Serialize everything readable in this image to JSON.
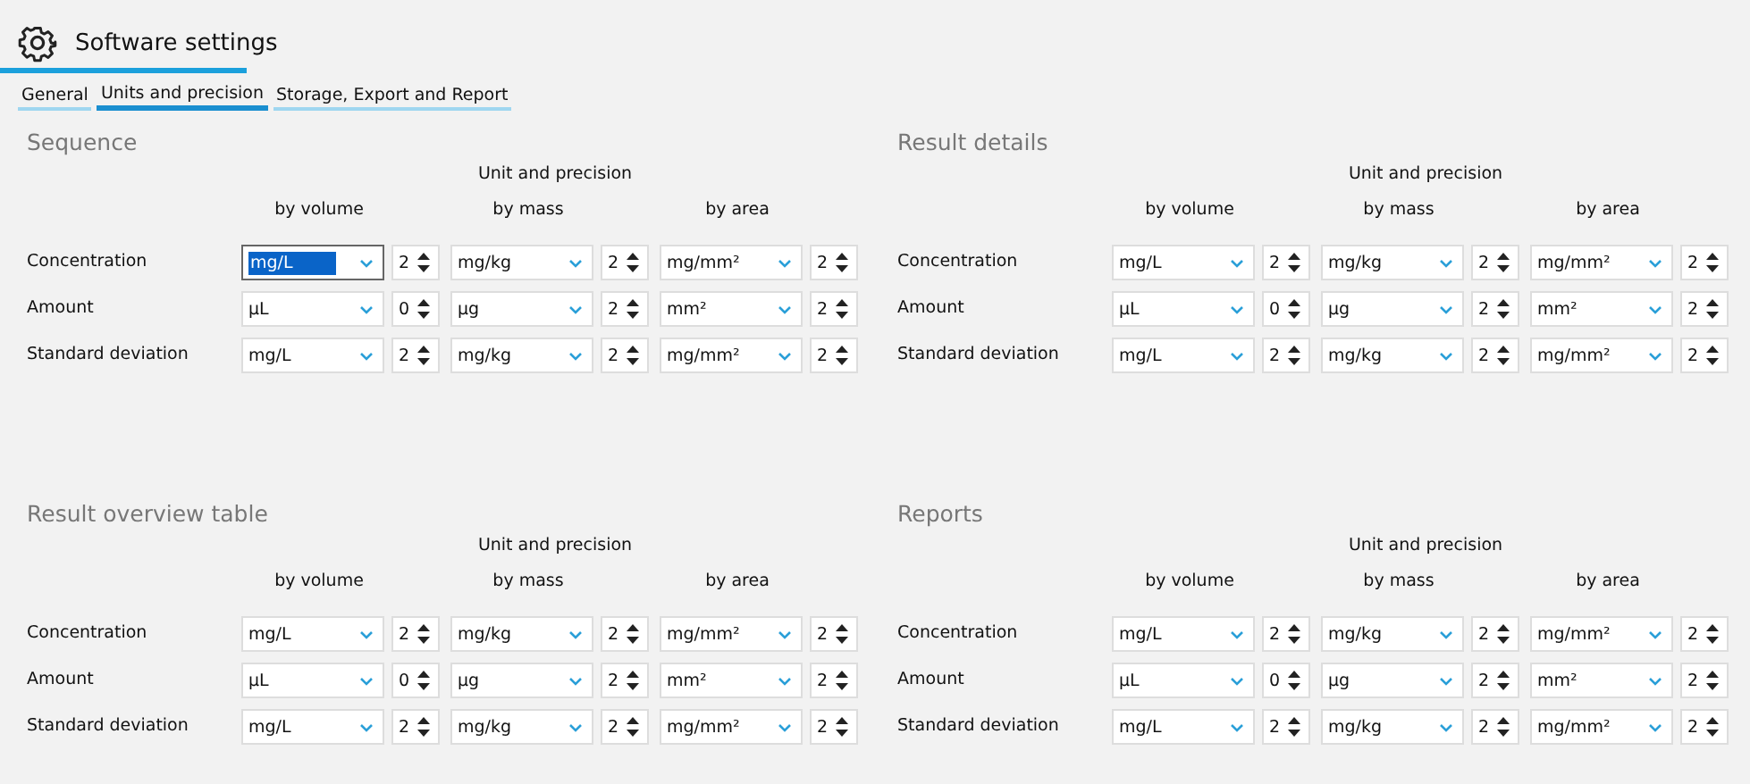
{
  "window": {
    "title": "Software settings"
  },
  "tabs": [
    {
      "label": "General",
      "selected": false
    },
    {
      "label": "Units and precision",
      "selected": true
    },
    {
      "label": "Storage, Export and Report",
      "selected": false
    }
  ],
  "sections": [
    {
      "title": "Sequence",
      "group_heading": "Unit and precision",
      "columns": [
        "by volume",
        "by mass",
        "by area"
      ],
      "rows": [
        {
          "label": "Concentration",
          "cells": [
            {
              "unit": "mg/L",
              "precision": "2",
              "focused": true
            },
            {
              "unit": "mg/kg",
              "precision": "2",
              "focused": false
            },
            {
              "unit": "mg/mm²",
              "precision": "2",
              "focused": false
            }
          ]
        },
        {
          "label": "Amount",
          "cells": [
            {
              "unit": "µL",
              "precision": "0",
              "focused": false
            },
            {
              "unit": "µg",
              "precision": "2",
              "focused": false
            },
            {
              "unit": "mm²",
              "precision": "2",
              "focused": false
            }
          ]
        },
        {
          "label": "Standard deviation",
          "cells": [
            {
              "unit": "mg/L",
              "precision": "2",
              "focused": false
            },
            {
              "unit": "mg/kg",
              "precision": "2",
              "focused": false
            },
            {
              "unit": "mg/mm²",
              "precision": "2",
              "focused": false
            }
          ]
        }
      ]
    },
    {
      "title": "Result details",
      "group_heading": "Unit and precision",
      "columns": [
        "by volume",
        "by mass",
        "by area"
      ],
      "rows": [
        {
          "label": "Concentration",
          "cells": [
            {
              "unit": "mg/L",
              "precision": "2",
              "focused": false
            },
            {
              "unit": "mg/kg",
              "precision": "2",
              "focused": false
            },
            {
              "unit": "mg/mm²",
              "precision": "2",
              "focused": false
            }
          ]
        },
        {
          "label": "Amount",
          "cells": [
            {
              "unit": "µL",
              "precision": "0",
              "focused": false
            },
            {
              "unit": "µg",
              "precision": "2",
              "focused": false
            },
            {
              "unit": "mm²",
              "precision": "2",
              "focused": false
            }
          ]
        },
        {
          "label": "Standard deviation",
          "cells": [
            {
              "unit": "mg/L",
              "precision": "2",
              "focused": false
            },
            {
              "unit": "mg/kg",
              "precision": "2",
              "focused": false
            },
            {
              "unit": "mg/mm²",
              "precision": "2",
              "focused": false
            }
          ]
        }
      ]
    },
    {
      "title": "Result overview table",
      "group_heading": "Unit and precision",
      "columns": [
        "by volume",
        "by mass",
        "by area"
      ],
      "rows": [
        {
          "label": "Concentration",
          "cells": [
            {
              "unit": "mg/L",
              "precision": "2",
              "focused": false
            },
            {
              "unit": "mg/kg",
              "precision": "2",
              "focused": false
            },
            {
              "unit": "mg/mm²",
              "precision": "2",
              "focused": false
            }
          ]
        },
        {
          "label": "Amount",
          "cells": [
            {
              "unit": "µL",
              "precision": "0",
              "focused": false
            },
            {
              "unit": "µg",
              "precision": "2",
              "focused": false
            },
            {
              "unit": "mm²",
              "precision": "2",
              "focused": false
            }
          ]
        },
        {
          "label": "Standard deviation",
          "cells": [
            {
              "unit": "mg/L",
              "precision": "2",
              "focused": false
            },
            {
              "unit": "mg/kg",
              "precision": "2",
              "focused": false
            },
            {
              "unit": "mg/mm²",
              "precision": "2",
              "focused": false
            }
          ]
        }
      ]
    },
    {
      "title": "Reports",
      "group_heading": "Unit and precision",
      "columns": [
        "by volume",
        "by mass",
        "by area"
      ],
      "rows": [
        {
          "label": "Concentration",
          "cells": [
            {
              "unit": "mg/L",
              "precision": "2",
              "focused": false
            },
            {
              "unit": "mg/kg",
              "precision": "2",
              "focused": false
            },
            {
              "unit": "mg/mm²",
              "precision": "2",
              "focused": false
            }
          ]
        },
        {
          "label": "Amount",
          "cells": [
            {
              "unit": "µL",
              "precision": "0",
              "focused": false
            },
            {
              "unit": "µg",
              "precision": "2",
              "focused": false
            },
            {
              "unit": "mm²",
              "precision": "2",
              "focused": false
            }
          ]
        },
        {
          "label": "Standard deviation",
          "cells": [
            {
              "unit": "mg/L",
              "precision": "2",
              "focused": false
            },
            {
              "unit": "mg/kg",
              "precision": "2",
              "focused": false
            },
            {
              "unit": "mg/mm²",
              "precision": "2",
              "focused": false
            }
          ]
        }
      ]
    }
  ]
}
